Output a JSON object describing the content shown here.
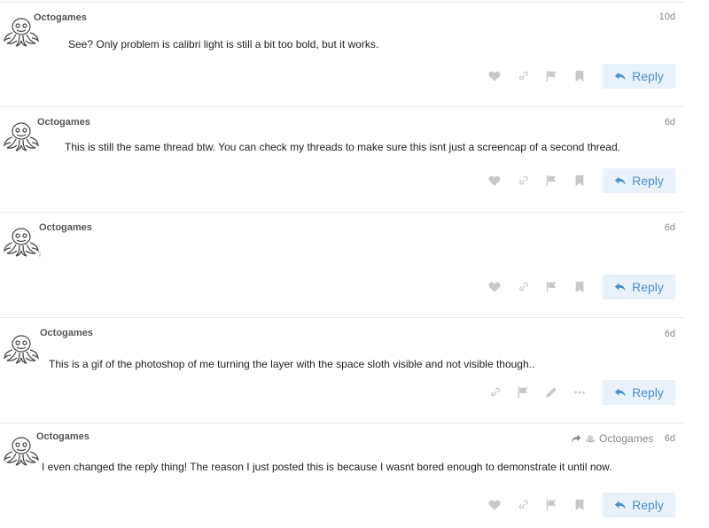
{
  "posts": [
    {
      "username": "Octogames",
      "date": "10d",
      "body": "See? Only problem is calibri light is still a bit too bold, but it works.",
      "reply_label": "Reply",
      "actions": [
        "heart-icon",
        "link-icon",
        "flag-icon",
        "bookmark-icon"
      ]
    },
    {
      "username": "Octogames",
      "date": "6d",
      "body": "This is still the same thread btw. You can check my threads to make sure this isnt just a screencap of a second thread.",
      "reply_label": "Reply",
      "actions": [
        "heart-icon",
        "link-icon",
        "flag-icon",
        "bookmark-icon"
      ]
    },
    {
      "username": "Octogames",
      "date": "6d",
      "body": "",
      "reply_label": "Reply",
      "actions": [
        "heart-icon",
        "link-icon",
        "flag-icon",
        "bookmark-icon"
      ]
    },
    {
      "username": "Octogames",
      "date": "6d",
      "body": "This is a gif of the photoshop of me turning the layer with the space sloth visible and not visible though..",
      "reply_label": "Reply",
      "actions": [
        "link-icon",
        "flag-icon",
        "pencil-icon",
        "more-icon"
      ]
    },
    {
      "username": "Octogames",
      "date": "6d",
      "body": "I even changed the reply thing! The reason I just posted this is because I wasnt bored enough to demonstrate it until now.",
      "reply_label": "Reply",
      "reply_to_user": "Octogames",
      "actions": [
        "heart-icon",
        "link-icon",
        "flag-icon",
        "bookmark-icon"
      ]
    }
  ],
  "colors": {
    "reply_bg": "#e9f2fb",
    "reply_text": "#4a90c8",
    "icon": "#c8c8c8",
    "divider": "#e9e9e9"
  }
}
